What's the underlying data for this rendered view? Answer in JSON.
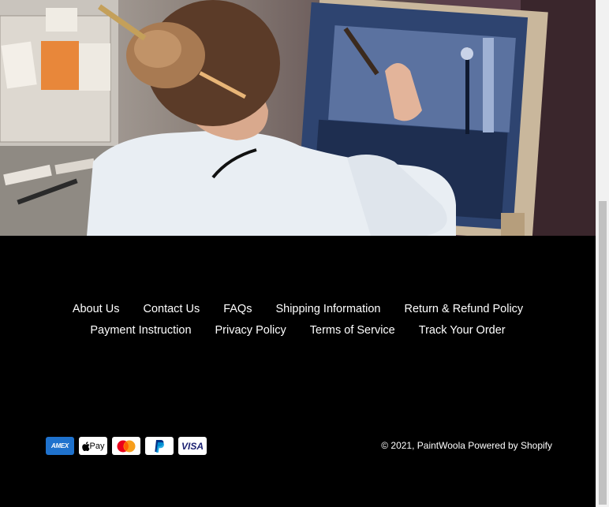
{
  "footer": {
    "nav_row_1": [
      {
        "label": "About Us"
      },
      {
        "label": "Contact Us"
      },
      {
        "label": "FAQs"
      },
      {
        "label": "Shipping Information"
      },
      {
        "label": "Return & Refund Policy"
      }
    ],
    "nav_row_2": [
      {
        "label": "Payment Instruction"
      },
      {
        "label": "Privacy Policy"
      },
      {
        "label": "Terms of Service"
      },
      {
        "label": "Track Your Order"
      }
    ],
    "payments": [
      {
        "name": "amex-icon",
        "label": "AMEX"
      },
      {
        "name": "apple-pay-icon",
        "label": " Pay"
      },
      {
        "name": "mastercard-icon",
        "label": ""
      },
      {
        "name": "paypal-icon",
        "label": "P"
      },
      {
        "name": "visa-icon",
        "label": "VISA"
      }
    ],
    "copyright": {
      "prefix": "© 2021, ",
      "store": "PaintWoola",
      "powered": "Powered by Shopify"
    }
  },
  "colors": {
    "footer_bg": "#000000",
    "text": "#ffffff",
    "amex": "#1f72cd",
    "mastercard_red": "#eb001b",
    "mastercard_orange": "#f79e1b",
    "paypal_blue": "#003087",
    "visa_blue": "#1a1f71"
  }
}
